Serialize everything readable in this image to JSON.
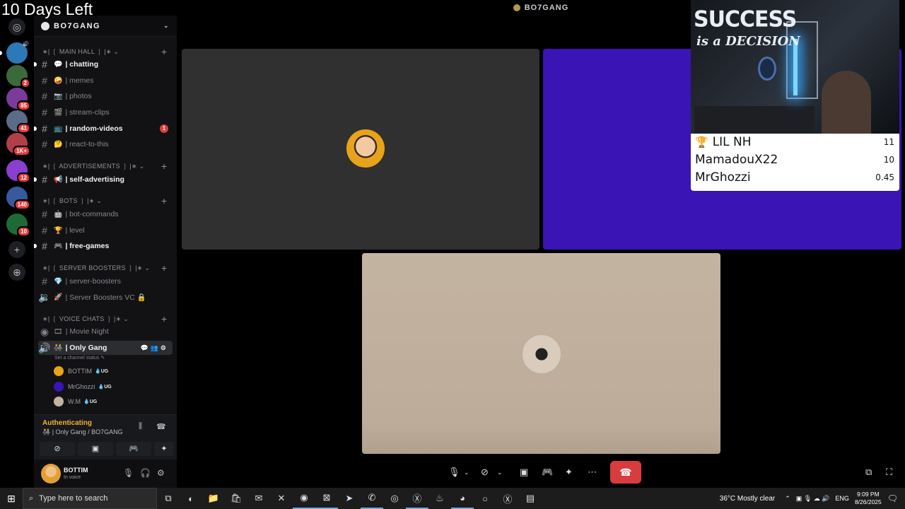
{
  "banner": "10 Days Left",
  "topbar": {
    "title": "BO7GANG"
  },
  "rail": {
    "servers": [
      {
        "badge": "",
        "color": "#2b79b8"
      },
      {
        "badge": "2",
        "color": "#3b6a3a"
      },
      {
        "badge": "85",
        "color": "#7a3b9a"
      },
      {
        "badge": "41",
        "color": "#5a6c86"
      },
      {
        "badge": "1K+",
        "color": "#b13f4a"
      },
      {
        "badge": "12",
        "color": "#8b3fd1"
      },
      {
        "badge": "140",
        "color": "#375a9e"
      },
      {
        "badge": "10",
        "color": "#1d6b34"
      }
    ]
  },
  "server": {
    "name": "BO7GANG"
  },
  "categories": {
    "main": "∗| ❲ MAIN HALL ❳ |∗",
    "ads": "∗| ❲ ADVERTISEMENTS ❳ |∗",
    "bots": "∗| ❲ BOTS ❳ |∗",
    "boost": "∗| ❲ SERVER BOOSTERS ❳ |∗",
    "voice": "∗| ❲ VOICE CHATS ❳ |∗"
  },
  "channels": [
    {
      "name": "| chatting",
      "emoji": "💬"
    },
    {
      "name": "| memes",
      "emoji": "🤪"
    },
    {
      "name": "| photos",
      "emoji": "📷"
    },
    {
      "name": "| stream-clips",
      "emoji": "🎬"
    },
    {
      "name": "| random-videos",
      "emoji": "📺",
      "mentions": "1"
    },
    {
      "name": "| react-to-this",
      "emoji": "🤔"
    },
    {
      "name": "| self-advertising",
      "emoji": "📢"
    },
    {
      "name": "| bot-commands",
      "emoji": "🤖"
    },
    {
      "name": "| level",
      "emoji": "🏆"
    },
    {
      "name": "| free-games",
      "emoji": "🎮"
    },
    {
      "name": "| server-boosters",
      "emoji": "💎"
    },
    {
      "name": "| Server Boosters VC 🔒",
      "emoji": "🚀"
    },
    {
      "name": "| Movie Night",
      "emoji": "🎞"
    },
    {
      "name": "| Only Gang",
      "emoji": "👫"
    }
  ],
  "channel_status": "Set a channel status ✎",
  "voice_users": [
    {
      "name": "BOTTIM",
      "tag": "💧UG"
    },
    {
      "name": "MrGhozzi",
      "tag": "💧UG"
    },
    {
      "name": "W.M",
      "tag": "💧UG"
    }
  ],
  "voice_panel": {
    "state": "Authenticating",
    "location": "👫 | Only Gang / BO7GANG"
  },
  "user_panel": {
    "name": "BOTTIM",
    "status": "In voice"
  },
  "cam": {
    "line1": "SUCCESS",
    "line2": "is a DECISION"
  },
  "leaderboard": [
    {
      "name": "LIL NH",
      "score": "11",
      "trophy": "🏆"
    },
    {
      "name": "MamadouX22",
      "score": "10"
    },
    {
      "name": "MrGhozzi",
      "score": "0.45"
    }
  ],
  "taskbar": {
    "search_placeholder": "Type here to search",
    "weather": "36°C  Mostly clear",
    "lang": "ENG",
    "time": "9:09 PM",
    "date": "8/26/2025"
  }
}
